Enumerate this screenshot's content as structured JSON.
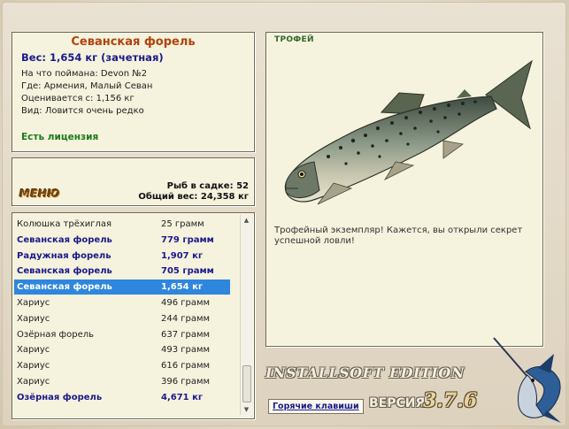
{
  "fish_info": {
    "title": "Севанская форель",
    "weight": "Вес: 1,654 кг (зачетная)",
    "caught_with": "На что поймана: Devon №2",
    "location": "Где: Армения, Малый Севан",
    "valued_from": "Оценивается с: 1,156 кг",
    "rarity": "Вид: Ловится очень редко",
    "license": "Есть лицензия"
  },
  "keepnet": {
    "menu_label": "МЕНЮ",
    "fish_count": "Рыб в садке: 52",
    "total_weight": "Общий вес: 24,358 кг"
  },
  "catch_list": [
    {
      "name": "Колюшка трёхиглая",
      "weight": "25 грамм",
      "bold": false,
      "selected": false
    },
    {
      "name": "Севанская форель",
      "weight": "779 грамм",
      "bold": true,
      "selected": false
    },
    {
      "name": "Радужная форель",
      "weight": "1,907 кг",
      "bold": true,
      "selected": false
    },
    {
      "name": "Севанская форель",
      "weight": "705 грамм",
      "bold": true,
      "selected": false
    },
    {
      "name": "Севанская форель",
      "weight": "1,654 кг",
      "bold": true,
      "selected": true
    },
    {
      "name": "Хариус",
      "weight": "496 грамм",
      "bold": false,
      "selected": false
    },
    {
      "name": "Хариус",
      "weight": "244 грамм",
      "bold": false,
      "selected": false
    },
    {
      "name": "Озёрная форель",
      "weight": "637 грамм",
      "bold": false,
      "selected": false
    },
    {
      "name": "Хариус",
      "weight": "493 грамм",
      "bold": false,
      "selected": false
    },
    {
      "name": "Хариус",
      "weight": "616 грамм",
      "bold": false,
      "selected": false
    },
    {
      "name": "Хариус",
      "weight": "396 грамм",
      "bold": false,
      "selected": false
    },
    {
      "name": "Озёрная форель",
      "weight": "4,671 кг",
      "bold": true,
      "selected": false
    }
  ],
  "trophy": {
    "label": "ТРОФЕЙ",
    "description": "Трофейный экземпляр! Кажется, вы открыли секрет успешной ловли!"
  },
  "branding": {
    "edition": "INSTALLSOFT EDITION",
    "version_label": "ВЕРСИЯ",
    "version_number": "3.7.6",
    "hotkeys_button": "Горячие клавиши"
  },
  "colors": {
    "accent_title": "#b0430c",
    "bold_entry": "#1a1a8a",
    "selection": "#2f86dd",
    "license": "#1b7a1b",
    "panel_bg": "#f5f2dd"
  }
}
